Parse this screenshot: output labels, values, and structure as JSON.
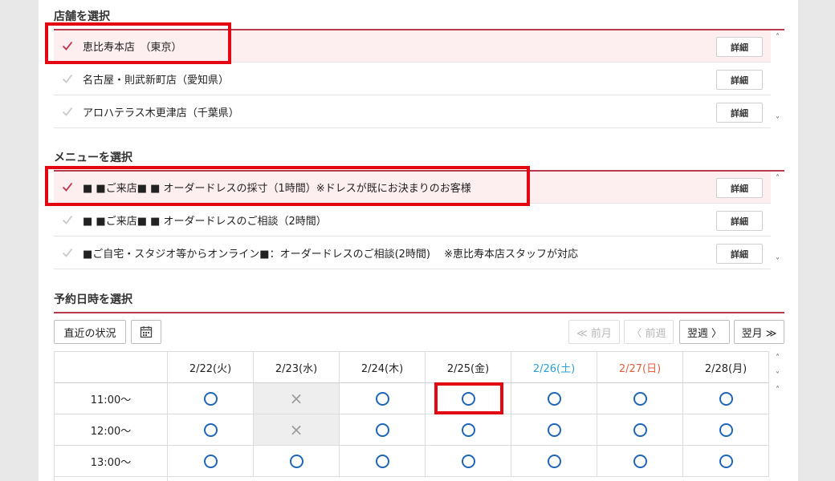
{
  "store_section": {
    "title": "店舗を選択",
    "detail_label": "詳細",
    "items": [
      {
        "label": "恵比寿本店　（東京）",
        "selected": true
      },
      {
        "label": "名古屋・則武新町店（愛知県）",
        "selected": false
      },
      {
        "label": "アロハテラス木更津店（千葉県）",
        "selected": false
      }
    ]
  },
  "menu_section": {
    "title": "メニューを選択",
    "detail_label": "詳細",
    "items": [
      {
        "label": "■ ■ご来店■ ■ オーダードレスの採寸（1時間）※ドレスが既にお決まりのお客様",
        "selected": true
      },
      {
        "label": "■ ■ご来店■ ■ オーダードレスのご相談（2時間）",
        "selected": false
      },
      {
        "label": "■ご自宅・スタジオ等からオンライン■：オーダードレスのご相談(2時間)　 ※恵比寿本店スタッフが対応",
        "selected": false
      }
    ]
  },
  "datetime_section": {
    "title": "予約日時を選択",
    "recent_button": "直近の状況",
    "calendar_icon": "calendar-icon",
    "prev_month": "≪ 前月",
    "prev_week": "〈 前週",
    "next_week": "翌週 〉",
    "next_month": "翌月 ≫",
    "dates": [
      {
        "label": "2/22(火)",
        "color": "#222222"
      },
      {
        "label": "2/23(水)",
        "color": "#222222"
      },
      {
        "label": "2/24(木)",
        "color": "#222222"
      },
      {
        "label": "2/25(金)",
        "color": "#222222"
      },
      {
        "label": "2/26(土)",
        "color": "#2a9fd6"
      },
      {
        "label": "2/27(日)",
        "color": "#e0603f"
      },
      {
        "label": "2/28(月)",
        "color": "#222222"
      }
    ],
    "rows": [
      {
        "time": "11:00〜",
        "slots": [
          "available",
          "unavailable",
          "available",
          "available",
          "available",
          "available",
          "available"
        ]
      },
      {
        "time": "12:00〜",
        "slots": [
          "available",
          "unavailable",
          "available",
          "available",
          "available",
          "available",
          "available"
        ]
      },
      {
        "time": "13:00〜",
        "slots": [
          "available",
          "available",
          "available",
          "available",
          "available",
          "available",
          "available"
        ]
      }
    ],
    "unavailable_mark": "×"
  },
  "colors": {
    "accent_rule": "#b73a4e",
    "selected_row_bg": "#fdeef0",
    "highlight_box": "#e30613",
    "available_circle": "#1f66b8",
    "saturday": "#2a9fd6",
    "sunday": "#e0603f"
  }
}
